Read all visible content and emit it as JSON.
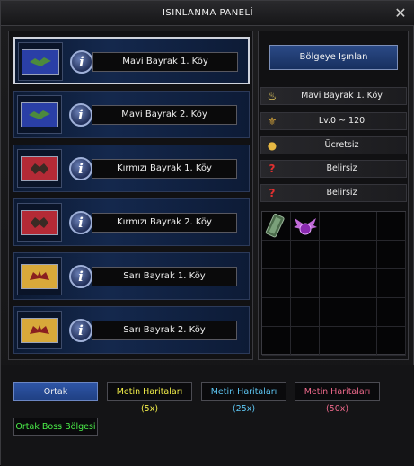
{
  "window": {
    "title": "ISINLANMA PANELİ",
    "close_symbol": "✕"
  },
  "villages": [
    {
      "label": "Mavi Bayrak 1. Köy",
      "flag": "blue",
      "selected": true
    },
    {
      "label": "Mavi Bayrak 2. Köy",
      "flag": "blue",
      "selected": false
    },
    {
      "label": "Kırmızı Bayrak 1. Köy",
      "flag": "red",
      "selected": false
    },
    {
      "label": "Kırmızı Bayrak 2. Köy",
      "flag": "red",
      "selected": false
    },
    {
      "label": "Sarı Bayrak 1. Köy",
      "flag": "yellow",
      "selected": false
    },
    {
      "label": "Sarı Bayrak 2. Köy",
      "flag": "yellow",
      "selected": false
    }
  ],
  "details": {
    "teleport_button": "Bölgeye Işınlan",
    "rows": [
      {
        "icon": "candle-icon",
        "text": "Mavi Bayrak 1. Köy"
      },
      {
        "icon": "level-icon",
        "text": "Lv.0 ~ 120"
      },
      {
        "icon": "gold-coins-icon",
        "text": "Ücretsiz"
      },
      {
        "icon": "question-icon",
        "text": "Belirsiz"
      },
      {
        "icon": "question-icon",
        "text": "Belirsiz"
      }
    ]
  },
  "rewards": {
    "items": [
      "scroll-item-icon",
      "winged-orb-item-icon"
    ]
  },
  "map_buttons": [
    {
      "label": "Ortak",
      "color": "#f2f2f2",
      "active": true
    },
    {
      "label": "Metin Haritaları (5x)",
      "color": "#f4f04a",
      "active": false
    },
    {
      "label": "Metin Haritaları (25x)",
      "color": "#5ec8f5",
      "active": false
    },
    {
      "label": "Metin Haritaları (50x)",
      "color": "#f06a8c",
      "active": false
    },
    {
      "label": "Ortak Boss Bölgesi",
      "color": "#4cf04a",
      "active": false
    }
  ]
}
